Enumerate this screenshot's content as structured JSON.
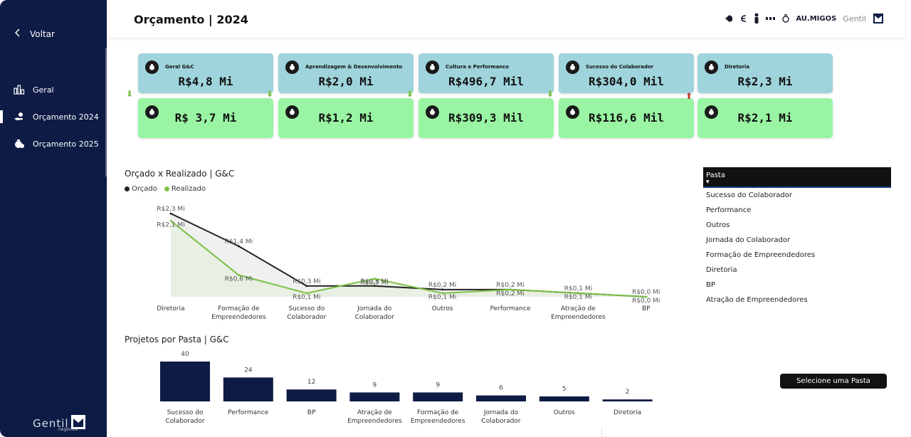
{
  "sidebar": {
    "back_label": "Voltar",
    "items": [
      {
        "label": "Geral",
        "icon": "bar-chart-icon"
      },
      {
        "label": "Orçamento 2024",
        "icon": "money-hand-icon"
      },
      {
        "label": "Orçamento 2025",
        "icon": "money-bag-icon"
      }
    ],
    "active_index": 1,
    "logo_text": "Gentil",
    "logo_sub": "negócios"
  },
  "header": {
    "title": "Orçamento | 2024",
    "brand_au": "AU.MIGOS",
    "brand_gentil": "Gentil"
  },
  "kpis": [
    {
      "label": "Geral G&C",
      "orcado": "R$4,8 Mi",
      "realizado": "R$ 3,7 Mi",
      "trend": "down",
      "trend_color": "#7ac143"
    },
    {
      "label": "Aprendizagem & Desenvolvimento",
      "orcado": "R$2,0 Mi",
      "realizado": "R$1,2 Mi",
      "trend": "down",
      "trend_color": "#7ac143"
    },
    {
      "label": "Cultura e Performance",
      "orcado": "R$496,7 Mil",
      "realizado": "R$309,3 Mil",
      "trend": "down",
      "trend_color": "#7ac143"
    },
    {
      "label": "Sucesso do Colaborador",
      "orcado": "R$304,0 Mil",
      "realizado": "R$116,6 Mil",
      "trend": "down",
      "trend_color": "#7ac143"
    },
    {
      "label": "Diretoria",
      "orcado": "R$2,3 Mi",
      "realizado": "R$2,1 Mi",
      "trend": "up",
      "trend_color": "#c0392b"
    }
  ],
  "colors": {
    "navy": "#0d1b45",
    "orcado": "#222222",
    "realizado": "#7ac143",
    "kpi_top": "#9fd4dc",
    "kpi_bottom": "#99f5a3",
    "bar": "#0d1b45"
  },
  "line_chart_title": "Orçado x Realizado | G&C",
  "legend": {
    "orcado": "Orçado",
    "realizado": "Realizado"
  },
  "bar_chart_title": "Projetos por Pasta | G&C",
  "chart_data": [
    {
      "type": "line",
      "title": "Orçado x Realizado | G&C",
      "categories": [
        "Diretoria",
        "Formação de Empreendedores",
        "Sucesso do Colaborador",
        "Jornada do Colaborador",
        "Outros",
        "Performance",
        "Atração de Empreendedores",
        "BP"
      ],
      "series": [
        {
          "name": "Orçado",
          "values": [
            2.3,
            1.4,
            0.3,
            0.3,
            0.2,
            0.2,
            0.1,
            0.0
          ],
          "labels": [
            "R$2,3 Mi",
            "R$1,4 Mi",
            "R$0,3 Mi",
            "R$0,3 Mi",
            "R$0,2 Mi",
            "R$0,2 Mi",
            "R$0,1 Mi",
            "R$0,0 Mi"
          ]
        },
        {
          "name": "Realizado",
          "values": [
            2.1,
            0.6,
            0.1,
            0.5,
            0.1,
            0.2,
            0.1,
            0.0
          ],
          "labels": [
            "R$2,1 Mi",
            "R$0,6 Mi",
            "R$0,1 Mi",
            "R$0,5 Mi",
            "R$0,1 Mi",
            "R$0,2 Mi",
            "R$0,1 Mi",
            "R$0,0 Mi"
          ]
        }
      ],
      "ylim": [
        0,
        2.4
      ]
    },
    {
      "type": "bar",
      "title": "Projetos por Pasta | G&C",
      "categories": [
        "Sucesso do Colaborador",
        "Performance",
        "BP",
        "Atração de Empreendedores",
        "Formação de Empreendedores",
        "Jornada do Colaborador",
        "Outros",
        "Diretoria"
      ],
      "values": [
        40,
        24,
        12,
        9,
        9,
        6,
        5,
        2
      ],
      "ylim": [
        0,
        40
      ]
    }
  ],
  "slicer": {
    "header": "Pasta",
    "items": [
      "Sucesso do Colaborador",
      "Performance",
      "Outros",
      "Jornada do Colaborador",
      "Formação de Empreendedores",
      "Diretoria",
      "BP",
      "Atração de Empreendedores"
    ]
  },
  "select_button": "Selecione uma Pasta"
}
